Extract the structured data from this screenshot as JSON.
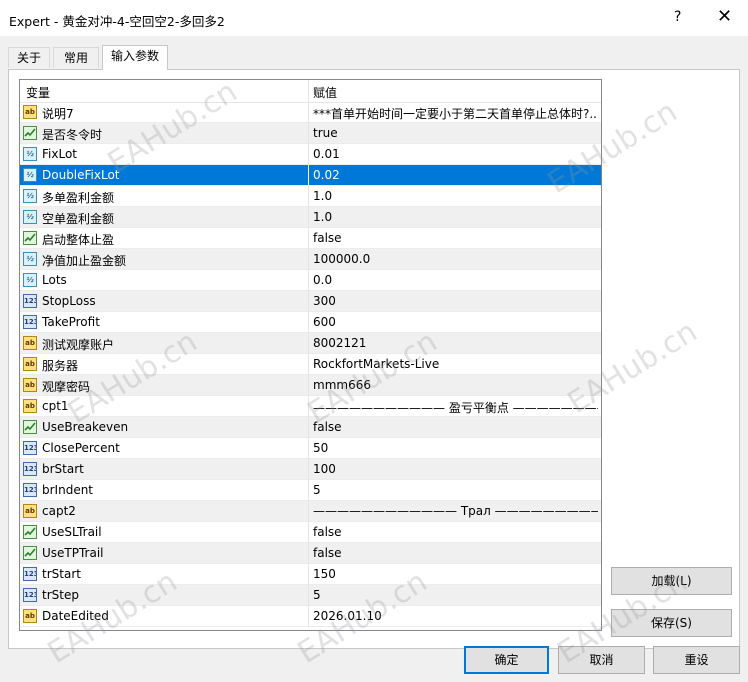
{
  "window": {
    "title": "Expert - 黄金对冲-4-空回空2-多回多2",
    "help_glyph": "?",
    "close_glyph": "✕"
  },
  "tabs": [
    {
      "label": "关于"
    },
    {
      "label": "常用"
    },
    {
      "label": "输入参数",
      "active": true
    }
  ],
  "grid": {
    "header": {
      "variable": "变量",
      "value": "赋值"
    },
    "rows": [
      {
        "type": "ab",
        "name": "说明7",
        "value": "***首单开始时间一定要小于第二天首单停止总体时?.."
      },
      {
        "type": "bool",
        "name": "是否冬令时",
        "value": "true"
      },
      {
        "type": "dbl",
        "name": "FixLot",
        "value": "0.01"
      },
      {
        "type": "dbl",
        "name": "DoubleFixLot",
        "value": "0.02",
        "selected": true
      },
      {
        "type": "dbl",
        "name": "多单盈利金额",
        "value": "1.0"
      },
      {
        "type": "dbl",
        "name": "空单盈利金额",
        "value": "1.0"
      },
      {
        "type": "bool",
        "name": "启动整体止盈",
        "value": "false"
      },
      {
        "type": "dbl",
        "name": "净值加止盈金额",
        "value": "100000.0"
      },
      {
        "type": "dbl",
        "name": "Lots",
        "value": "0.0"
      },
      {
        "type": "int",
        "name": "StopLoss",
        "value": "300"
      },
      {
        "type": "int",
        "name": "TakeProfit",
        "value": "600"
      },
      {
        "type": "ab",
        "name": "测试观摩账户",
        "value": "8002121"
      },
      {
        "type": "ab",
        "name": "服务器",
        "value": "RockfortMarkets-Live"
      },
      {
        "type": "ab",
        "name": "观摩密码",
        "value": "mmm666"
      },
      {
        "type": "ab",
        "name": "cpt1",
        "value": "——————————— 盈亏平衡点 ——————————"
      },
      {
        "type": "bool",
        "name": "UseBreakeven",
        "value": "false"
      },
      {
        "type": "int",
        "name": "ClosePercent",
        "value": "50"
      },
      {
        "type": "int",
        "name": "brStart",
        "value": "100"
      },
      {
        "type": "int",
        "name": "brIndent",
        "value": "5"
      },
      {
        "type": "ab",
        "name": "capt2",
        "value": "———————————— Трал ————————————?.."
      },
      {
        "type": "bool",
        "name": "UseSLTrail",
        "value": "false"
      },
      {
        "type": "bool",
        "name": "UseTPTrail",
        "value": "false"
      },
      {
        "type": "int",
        "name": "trStart",
        "value": "150"
      },
      {
        "type": "int",
        "name": "trStep",
        "value": "5"
      },
      {
        "type": "ab",
        "name": "DateEdited",
        "value": "2026.01.10"
      }
    ]
  },
  "icons": {
    "ab": "ab",
    "bool": "",
    "dbl": "½",
    "int": "123"
  },
  "buttons": {
    "load": "加载(L)",
    "save": "保存(S)",
    "ok": "确定",
    "cancel": "取消",
    "reset": "重设"
  },
  "watermark": "EAHub.cn",
  "colors": {
    "selection": "#0078d7",
    "alt_row": "#f0f0f0"
  }
}
